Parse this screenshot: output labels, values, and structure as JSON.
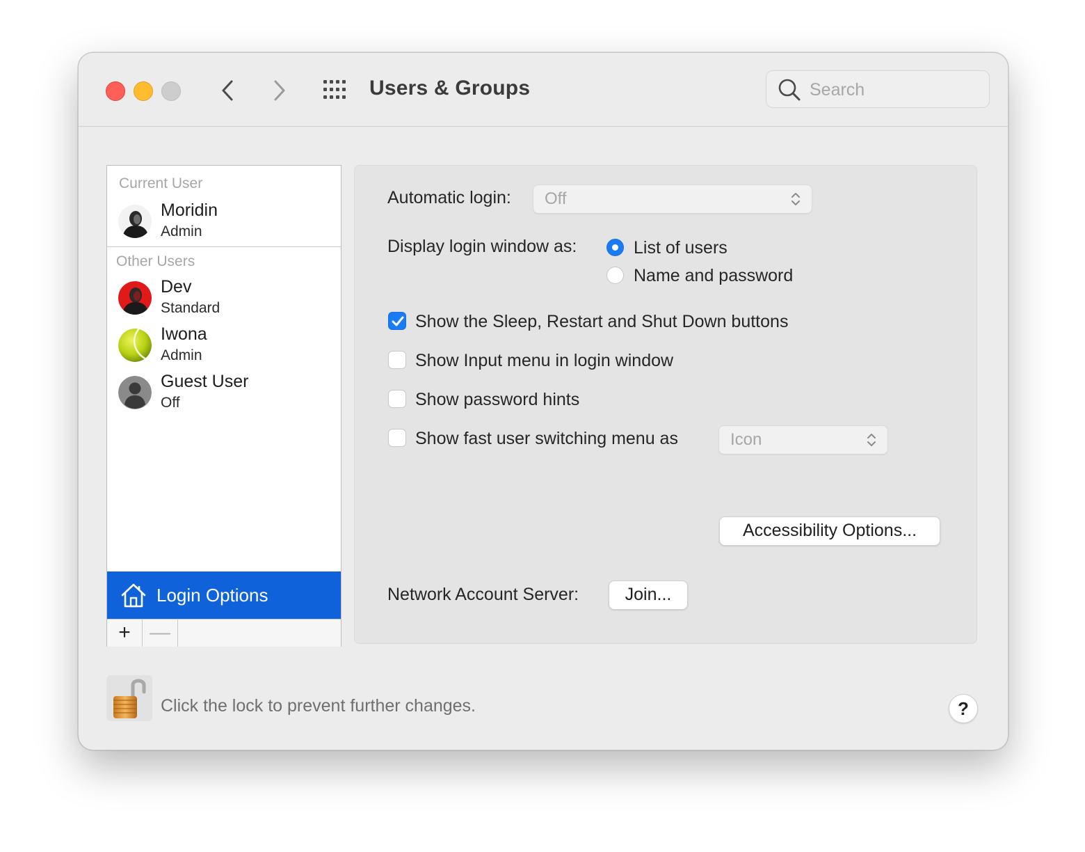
{
  "window": {
    "title": "Users & Groups",
    "search_placeholder": "Search"
  },
  "sidebar": {
    "current_user_label": "Current User",
    "current_user": {
      "name": "Moridin",
      "role": "Admin",
      "avatar": "portrait-photo-bw"
    },
    "other_users_label": "Other Users",
    "other_users": [
      {
        "name": "Dev",
        "role": "Standard",
        "avatar": "portrait-photo-red"
      },
      {
        "name": "Iwona",
        "role": "Admin",
        "avatar": "tennis-ball"
      },
      {
        "name": "Guest User",
        "role": "Off",
        "avatar": "generic-person"
      }
    ],
    "login_options_label": "Login Options",
    "add_label": "+",
    "remove_label": "—"
  },
  "panel": {
    "automatic_login_label": "Automatic login:",
    "automatic_login_value": "Off",
    "display_login_label": "Display login window as:",
    "display_options": [
      {
        "label": "List of users",
        "selected": true
      },
      {
        "label": "Name and password",
        "selected": false
      }
    ],
    "checkboxes": [
      {
        "label": "Show the Sleep, Restart and Shut Down buttons",
        "checked": true
      },
      {
        "label": "Show Input menu in login window",
        "checked": false
      },
      {
        "label": "Show password hints",
        "checked": false
      },
      {
        "label": "Show fast user switching menu as",
        "checked": false
      }
    ],
    "fast_switch_value": "Icon",
    "accessibility_button": "Accessibility Options...",
    "network_server_label": "Network Account Server:",
    "join_button": "Join..."
  },
  "footer": {
    "lock_text": "Click the lock to prevent further changes.",
    "help_label": "?"
  },
  "colors": {
    "accent": "#1a7cf5",
    "selection": "#0f62d9",
    "close": "#fe5f57",
    "minimize": "#febc2e",
    "zoom": "#cdcdcd"
  }
}
